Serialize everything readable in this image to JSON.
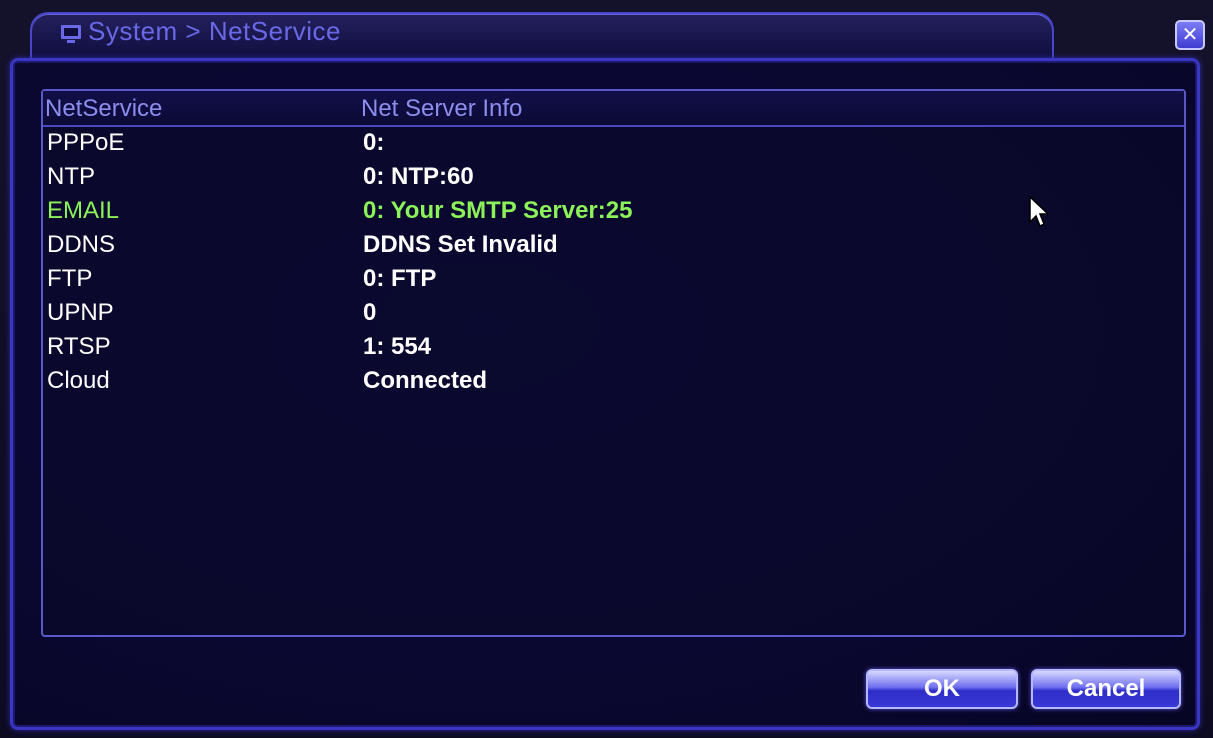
{
  "window": {
    "title": "System > NetService",
    "close_icon": "close-icon"
  },
  "table": {
    "headers": [
      "NetService",
      "Net Server Info"
    ],
    "rows": [
      {
        "name": "PPPoE",
        "info": "0:"
      },
      {
        "name": "NTP",
        "info": "0: NTP:60"
      },
      {
        "name": "EMAIL",
        "info": "0: Your SMTP Server:25"
      },
      {
        "name": "DDNS",
        "info": "DDNS Set Invalid"
      },
      {
        "name": "FTP",
        "info": "0: FTP"
      },
      {
        "name": "UPNP",
        "info": "0"
      },
      {
        "name": "RTSP",
        "info": "1: 554"
      },
      {
        "name": "Cloud",
        "info": "Connected"
      }
    ],
    "selected_index": 2
  },
  "buttons": {
    "ok": "OK",
    "cancel": "Cancel"
  },
  "colors": {
    "selected_text": "#8cf25a",
    "header_text": "#8e8dee",
    "border": "#3b37c4"
  }
}
